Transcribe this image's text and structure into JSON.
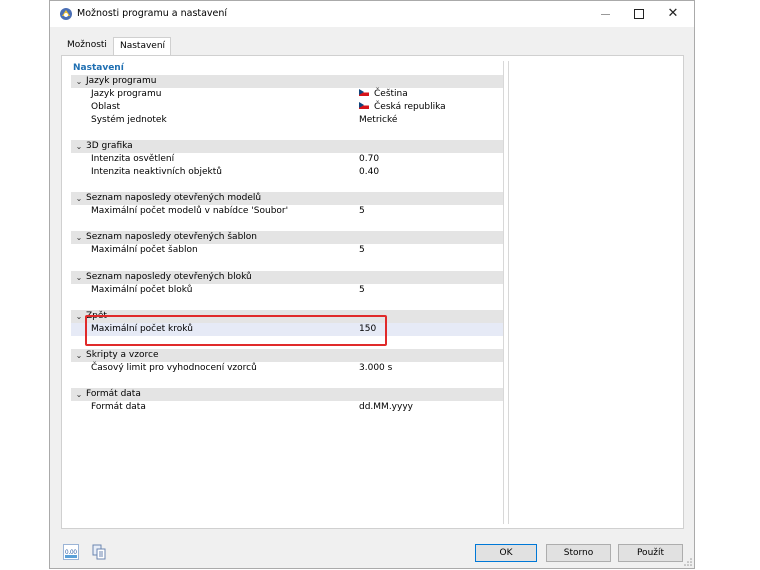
{
  "window": {
    "title": "Možnosti programu a nastavení",
    "controls": {
      "minimize": "—",
      "maximize": "☐",
      "close": "✕"
    }
  },
  "tabs": [
    {
      "label": "Možnosti",
      "active": false
    },
    {
      "label": "Nastavení",
      "active": true
    }
  ],
  "grid": {
    "header": "Nastavení",
    "categories": [
      {
        "label": "Jazyk programu",
        "rows": [
          {
            "label": "Jazyk programu",
            "value": "Čeština",
            "flag": "cz"
          },
          {
            "label": "Oblast",
            "value": "Česká republika",
            "flag": "cz"
          },
          {
            "label": "Systém jednotek",
            "value": "Metrické"
          }
        ]
      },
      {
        "label": "3D grafika",
        "rows": [
          {
            "label": "Intenzita osvětlení",
            "value": "0.70"
          },
          {
            "label": "Intenzita neaktivních objektů",
            "value": "0.40"
          }
        ]
      },
      {
        "label": "Seznam naposledy otevřených modelů",
        "rows": [
          {
            "label": "Maximální počet modelů v nabídce 'Soubor'",
            "value": "5"
          }
        ]
      },
      {
        "label": "Seznam naposledy otevřených šablon",
        "rows": [
          {
            "label": "Maximální počet šablon",
            "value": "5"
          }
        ]
      },
      {
        "label": "Seznam naposledy otevřených bloků",
        "rows": [
          {
            "label": "Maximální počet bloků",
            "value": "5"
          }
        ]
      },
      {
        "label": "Zpět",
        "rows": [
          {
            "label": "Maximální počet kroků",
            "value": "150",
            "selected": true
          }
        ]
      },
      {
        "label": "Skripty a vzorce",
        "rows": [
          {
            "label": "Časový limit pro vyhodnocení vzorců",
            "value": "3.000 s"
          }
        ]
      },
      {
        "label": "Formát data",
        "rows": [
          {
            "label": "Formát data",
            "value": "dd.MM.yyyy"
          }
        ]
      }
    ]
  },
  "icons": {
    "app": "rfem-app-icon",
    "units": "decimal-units-icon",
    "copy": "copy-settings-icon",
    "expand": "chevron-down-icon"
  },
  "bottom": {
    "units_label": "0.00",
    "ok": "OK",
    "storno": "Storno",
    "pouzit": "Použít"
  },
  "colors": {
    "highlight_border": "#e02a2a",
    "selected_row": "#e6eaf6",
    "category_bg": "#e4e4e4",
    "header_text": "#1f6fb2"
  }
}
